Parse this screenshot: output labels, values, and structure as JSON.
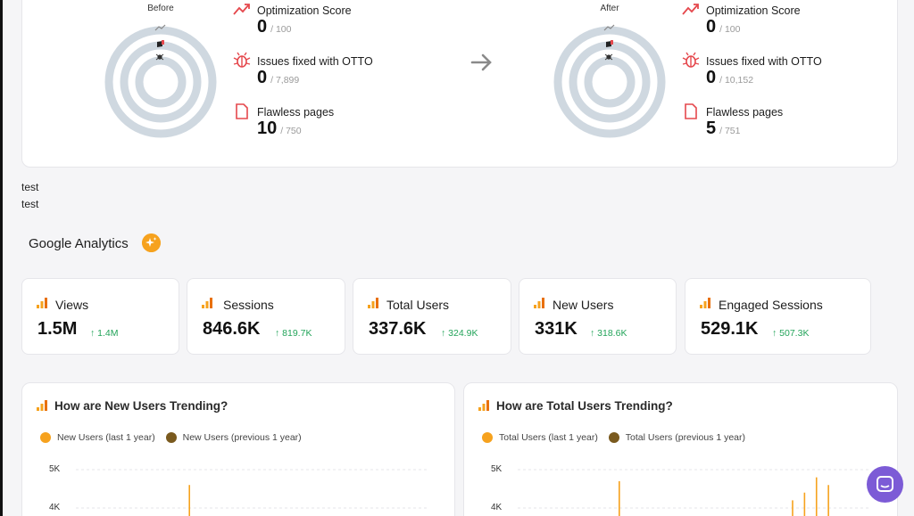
{
  "comparison": {
    "arrow_icon": "arrow-right-icon",
    "before": {
      "label": "Before",
      "metrics": [
        {
          "title": "Optimization Score",
          "value": "0",
          "total": "/ 100",
          "icon": "trend-up-icon"
        },
        {
          "title": "Issues fixed with OTTO",
          "value": "0",
          "total": "/ 7,899",
          "icon": "bug-icon"
        },
        {
          "title": "Flawless pages",
          "value": "10",
          "total": "/ 750",
          "icon": "page-icon"
        }
      ]
    },
    "after": {
      "label": "After",
      "metrics": [
        {
          "title": "Optimization Score",
          "value": "0",
          "total": "/ 100",
          "icon": "trend-up-icon"
        },
        {
          "title": "Issues fixed with OTTO",
          "value": "0",
          "total": "/ 10,152",
          "icon": "bug-icon"
        },
        {
          "title": "Flawless pages",
          "value": "5",
          "total": "/ 751",
          "icon": "page-icon"
        }
      ]
    }
  },
  "notes": [
    "test",
    "test"
  ],
  "analytics": {
    "title": "Google Analytics",
    "badge_icon": "sparkle-icon",
    "stats": [
      {
        "label": "Views",
        "value": "1.5M",
        "delta": "↑ 1.4M"
      },
      {
        "label": "Sessions",
        "value": "846.6K",
        "delta": "↑ 819.7K"
      },
      {
        "label": "Total Users",
        "value": "337.6K",
        "delta": "↑ 324.9K"
      },
      {
        "label": "New Users",
        "value": "331K",
        "delta": "↑ 318.6K"
      },
      {
        "label": "Engaged Sessions",
        "value": "529.1K",
        "delta": "↑ 507.3K"
      }
    ]
  },
  "colors": {
    "accent": "#f6a21e",
    "delta_up": "#23a45a",
    "ring": "#cfd8e0",
    "danger": "#e5484d",
    "fab": "#7c5bd6",
    "series_previous": "#7a5a1e"
  },
  "chart_data": [
    {
      "type": "line",
      "title": "How are New Users Trending?",
      "series": [
        {
          "name": "New Users (last 1 year)",
          "color": "#f6a21e",
          "values": [
            0,
            0,
            0,
            0,
            0,
            0,
            0,
            0,
            0,
            0,
            0,
            0,
            0,
            0,
            0,
            0,
            0,
            0,
            0,
            4600,
            0,
            0,
            0,
            0,
            0,
            0,
            0,
            0,
            0,
            0,
            0,
            0,
            0,
            0,
            0,
            0,
            0,
            0,
            0,
            0,
            0,
            0,
            0,
            0,
            0,
            0,
            0,
            0,
            0,
            0,
            0,
            0,
            0,
            0,
            0,
            0,
            0,
            0,
            0,
            0
          ]
        },
        {
          "name": "New Users (previous 1 year)",
          "color": "#7a5a1e",
          "values": []
        }
      ],
      "yticks": [
        "5K",
        "4K"
      ],
      "ylim": [
        0,
        5000
      ]
    },
    {
      "type": "line",
      "title": "How are Total Users Trending?",
      "series": [
        {
          "name": "Total Users (last 1 year)",
          "color": "#f6a21e",
          "values": [
            0,
            0,
            0,
            0,
            0,
            0,
            0,
            0,
            0,
            0,
            0,
            0,
            0,
            0,
            0,
            0,
            0,
            4700,
            0,
            0,
            0,
            0,
            0,
            0,
            0,
            0,
            0,
            0,
            0,
            0,
            0,
            0,
            0,
            0,
            0,
            0,
            0,
            0,
            0,
            0,
            0,
            0,
            0,
            0,
            0,
            3600,
            4200,
            3300,
            4400,
            3700,
            4800,
            3400,
            4600,
            0,
            0,
            0,
            0,
            0,
            0,
            3700
          ]
        },
        {
          "name": "Total Users (previous 1 year)",
          "color": "#7a5a1e",
          "values": []
        }
      ],
      "yticks": [
        "5K",
        "4K"
      ],
      "ylim": [
        0,
        5000
      ]
    }
  ],
  "support": {
    "icon": "chat-icon"
  }
}
